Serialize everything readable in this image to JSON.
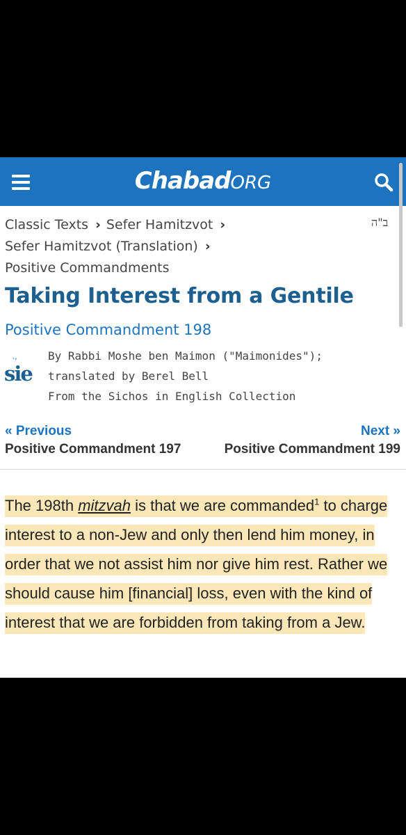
{
  "header": {
    "brand": "Chabad",
    "brand_suffix": "ORG",
    "menu_icon": "menu-icon",
    "search_icon": "search-icon",
    "background_color": "#1e73be"
  },
  "breadcrumb": {
    "items": [
      "Classic Texts",
      "Sefer Hamitzvot",
      "Sefer Hamitzvot (Translation)",
      "Positive Commandments"
    ],
    "separator_icon": "chevron-right-icon"
  },
  "hebrew_mark": "ב\"ה",
  "article": {
    "title": "Taking Interest from a Gentile",
    "subtitle": "Positive Commandment 198",
    "publisher_logo_text": "sie",
    "byline": [
      "By Rabbi Moshe ben Maimon (\"Maimonides\");",
      "translated by Berel Bell",
      "From the Sichos in English Collection"
    ]
  },
  "navigation": {
    "previous_label": "« Previous",
    "previous_target": "Positive Commandment 197",
    "next_label": "Next »",
    "next_target": "Positive Commandment 199"
  },
  "body": {
    "p1_a": "The 198th ",
    "p1_term": "mitzvah",
    "p1_b": " is that we are commanded",
    "footnote": "1",
    "p1_c": " to charge interest to a non-Jew and only then lend him money, in order that we not assist him nor give him rest. Rather we should cause him [financial] loss, even with the kind of interest that we are forbidden from taking from a Jew.",
    "highlight_color": "#fbe7b7"
  }
}
